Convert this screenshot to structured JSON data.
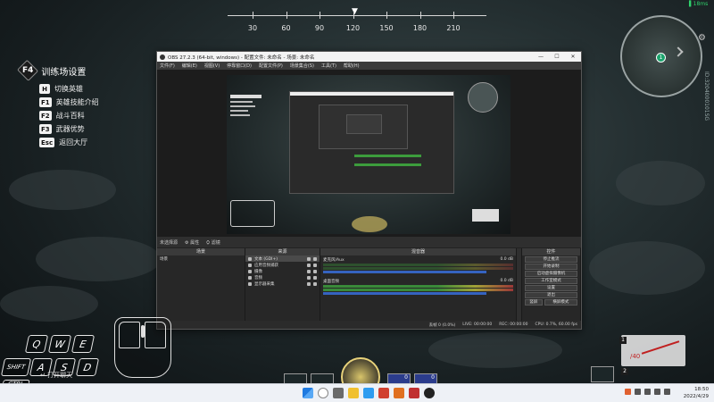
{
  "game": {
    "compass": {
      "labels": [
        "30",
        "60",
        "90",
        "120",
        "150",
        "180",
        "210"
      ],
      "marker": "▼"
    },
    "training_menu": {
      "title_key": "F4",
      "title": "训练场设置",
      "items": [
        {
          "key": "H",
          "label": "切换英雄"
        },
        {
          "key": "F1",
          "label": "英雄技能介绍"
        },
        {
          "key": "F2",
          "label": "战斗百科"
        },
        {
          "key": "F3",
          "label": "武器优势"
        },
        {
          "key": "Esc",
          "label": "返回大厅"
        }
      ]
    },
    "minimap": {
      "player_number": "1"
    },
    "ping": "18ms",
    "sidebar_id": "ID:3204000101SG",
    "keyboard": {
      "keys": [
        "Q",
        "W",
        "E",
        "A",
        "S",
        "D"
      ],
      "shift": "SHIFT",
      "ctrl": "CTRL"
    },
    "chat_hint": "↵ 打开聊天",
    "skills": {
      "slot_numbers": [
        "",
        "",
        "",
        "0",
        "0"
      ]
    },
    "weapon": {
      "slots": [
        "1",
        "2"
      ],
      "count": "/40"
    }
  },
  "obs": {
    "title": "OBS 27.2.3 (64-bit, windows) - 配置文件: 未命名 - 场景: 未命名",
    "window_buttons": [
      "—",
      "☐",
      "✕"
    ],
    "menu": [
      "文件(F)",
      "编辑(E)",
      "视图(V)",
      "停靠窗口(D)",
      "配置文件(P)",
      "场景集合(S)",
      "工具(T)",
      "帮助(H)"
    ],
    "scene_bar": {
      "label": "未选择源",
      "props": "属性",
      "filter": "滤镜"
    },
    "docks": {
      "scenes": {
        "title": "场景",
        "items": [
          "场景"
        ]
      },
      "sources": {
        "title": "来源",
        "items": [
          "文本 (GDI+)",
          "应用音频捕获",
          "摄像",
          "音频",
          "显示器采集"
        ]
      },
      "mixer": {
        "title": "混音器",
        "channels": [
          {
            "name": "麦克风/Aux",
            "db": "0.0 dB"
          },
          {
            "name": "桌面音频",
            "db": "0.0 dB"
          }
        ]
      },
      "controls": {
        "title": "控件",
        "buttons": [
          "停止推流",
          "开始录制",
          "启动虚拟摄像机",
          "工作室模式",
          "设置",
          "退出"
        ],
        "mode_toggle": [
          "竖屏",
          "横屏模式"
        ]
      }
    },
    "status": {
      "live": "LIVE: 00:00:00",
      "rec": "REC: 00:00:00",
      "cpu": "CPU: 0.7%, 60.00 fps",
      "dropped": "丢帧 0 (0.0%)"
    }
  },
  "taskbar": {
    "time": "18:50",
    "date": "2022/4/29"
  }
}
